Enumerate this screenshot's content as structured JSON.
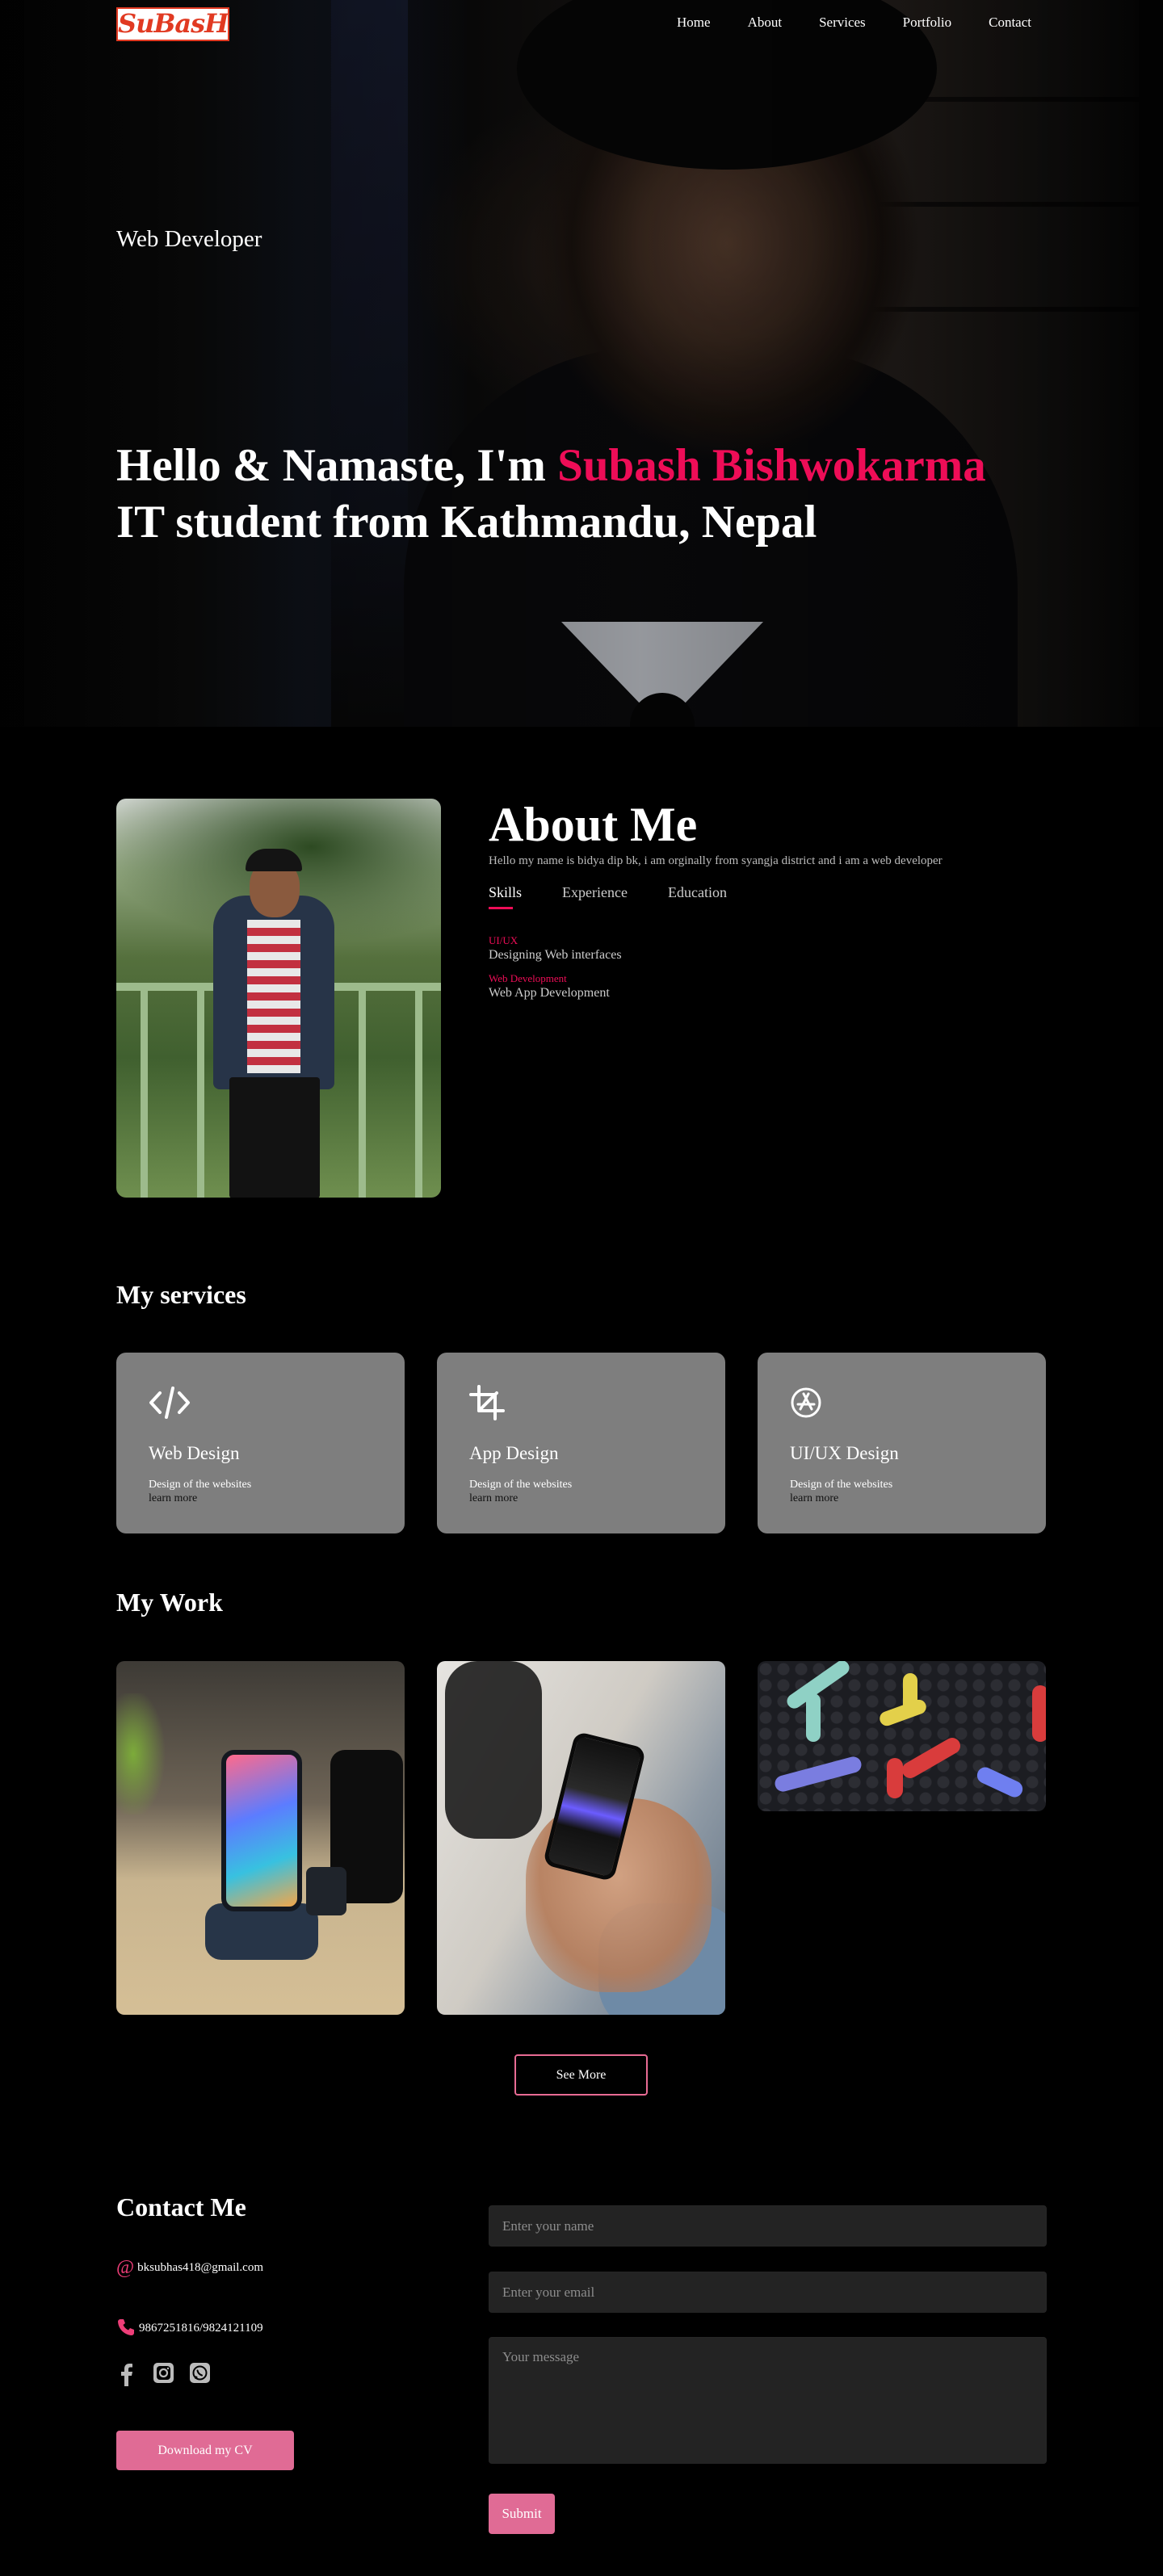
{
  "brand": {
    "logo_text": "SuBasH"
  },
  "nav": {
    "items": [
      "Home",
      "About",
      "Services",
      "Portfolio",
      "Contact"
    ]
  },
  "hero": {
    "role": "Web Developer",
    "greeting": "Hello & Namaste, I'm ",
    "name": "Subash Bishwokarma",
    "subtitle": "IT student from Kathmandu, Nepal"
  },
  "about": {
    "heading": "About Me",
    "text": "Hello my name is bidya dip bk, i am orginally from syangja district and i am a web developer",
    "tabs": [
      "Skills",
      "Experience",
      "Education"
    ],
    "skills": [
      {
        "title": "UI/UX",
        "desc": "Designing Web interfaces"
      },
      {
        "title": "Web Development",
        "desc": "Web App Development"
      }
    ]
  },
  "services": {
    "heading": "My services",
    "cards": [
      {
        "icon": "code-icon",
        "title": "Web Design",
        "desc": "Design of the websites",
        "link": "learn more"
      },
      {
        "icon": "crop-icon",
        "title": "App Design",
        "desc": "Design of the websites",
        "link": "learn more"
      },
      {
        "icon": "app-store-icon",
        "title": "UI/UX Design",
        "desc": "Design of the websites",
        "link": "learn more"
      }
    ]
  },
  "work": {
    "heading": "My Work",
    "see_more": "See More"
  },
  "contact": {
    "heading": "Contact Me",
    "email": "bksubhas418@gmail.com",
    "phone": "9867251816/9824121109",
    "socials": [
      "facebook-icon",
      "instagram-icon",
      "whatsapp-icon"
    ],
    "cv_button": "Download my CV",
    "name_placeholder": "Enter your name",
    "email_placeholder": "Enter your email",
    "message_placeholder": "Your message",
    "submit": "Submit"
  },
  "colors": {
    "accent": "#ee0d57",
    "button": "#e06b95",
    "card": "#7e7e7e",
    "field": "#232323"
  }
}
